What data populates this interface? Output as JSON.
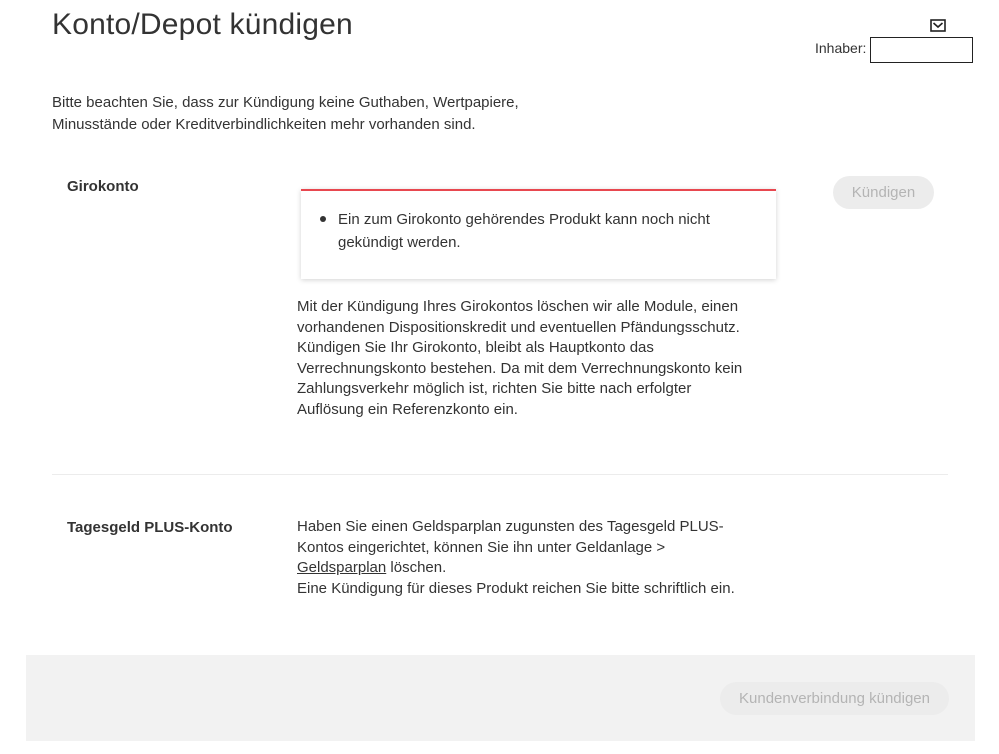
{
  "header": {
    "title": "Konto/Depot kündigen",
    "mail_icon": "mail-icon",
    "owner_label": "Inhaber:",
    "owner_value": ""
  },
  "intro": {
    "line1": "Bitte beachten Sie, dass zur Kündigung keine Guthaben, Wertpapiere,",
    "line2": "Minusstände oder Kreditverbindlichkeiten mehr vorhanden sind."
  },
  "girokonto": {
    "label": "Girokonto",
    "button_label": "Kündigen",
    "error_line1": "Ein zum Girokonto gehörendes Produkt kann noch nicht",
    "error_line2": "gekündigt werden.",
    "lines": [
      "Mit der Kündigung Ihres Girokontos löschen wir alle Module, einen",
      "vorhandenen Dispositionskredit und eventuellen Pfändungsschutz.",
      "Kündigen Sie Ihr Girokonto, bleibt als Hauptkonto das",
      "Verrechnungskonto bestehen. Da mit dem Verrechnungskonto kein",
      "Zahlungsverkehr möglich ist, richten Sie bitte nach erfolgter",
      "Auflösung ein Referenzkonto ein."
    ]
  },
  "tagesgeld": {
    "label": "Tagesgeld PLUS-Konto",
    "line1": "Haben Sie einen Geldsparplan zugunsten des Tagesgeld PLUS-",
    "line2": "Kontos eingerichtet, können Sie ihn unter Geldanlage >",
    "link": "Geldsparplan",
    "line3_suffix": " löschen.",
    "line4": "Eine Kündigung für dieses Produkt reichen Sie bitte schriftlich ein."
  },
  "footer": {
    "button_label": "Kundenverbindung kündigen"
  },
  "colors": {
    "error_accent": "#e8474f",
    "disabled_button_bg": "#ececec",
    "disabled_button_text": "#b4b4b4",
    "footer_bg": "#f2f2f2"
  }
}
